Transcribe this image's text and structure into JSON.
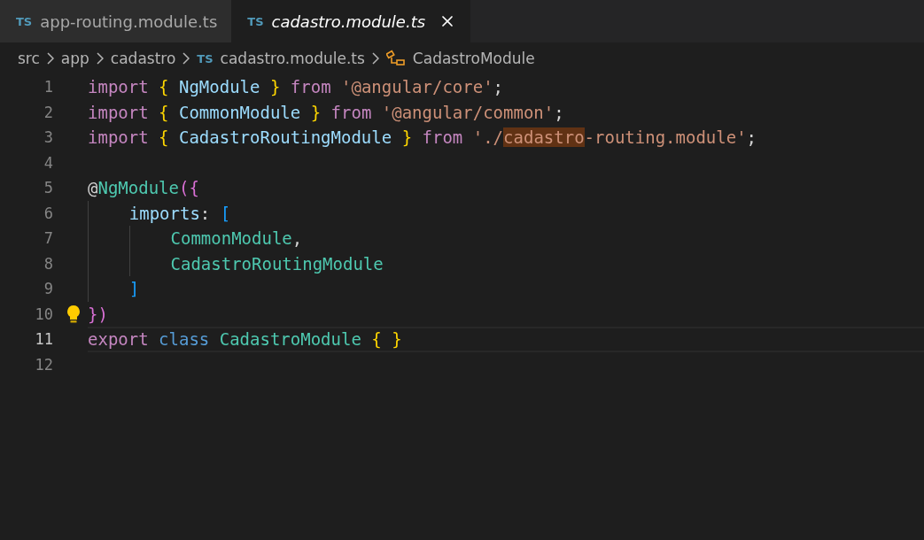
{
  "tabs": [
    {
      "badge": "TS",
      "label": "app-routing.module.ts",
      "selected": false
    },
    {
      "badge": "TS",
      "label": "cadastro.module.ts",
      "selected": true
    }
  ],
  "breadcrumbs": [
    {
      "kind": "folder",
      "label": "src"
    },
    {
      "kind": "folder",
      "label": "app"
    },
    {
      "kind": "folder",
      "label": "cadastro"
    },
    {
      "kind": "file",
      "badge": "TS",
      "label": "cadastro.module.ts"
    },
    {
      "kind": "symbol",
      "label": "CadastroModule"
    }
  ],
  "lines": [
    {
      "number": "1",
      "current": false,
      "tokens": [
        {
          "kind": "keyword",
          "text": "import "
        },
        {
          "kind": "brace",
          "text": "{"
        },
        {
          "kind": "variable",
          "text": " NgModule "
        },
        {
          "kind": "brace",
          "text": "} "
        },
        {
          "kind": "keyword",
          "text": "from "
        },
        {
          "kind": "string",
          "text": "'@angular/core'"
        },
        {
          "kind": "plain",
          "text": ";"
        }
      ]
    },
    {
      "number": "2",
      "current": false,
      "tokens": [
        {
          "kind": "keyword",
          "text": "import "
        },
        {
          "kind": "brace",
          "text": "{"
        },
        {
          "kind": "variable",
          "text": " CommonModule "
        },
        {
          "kind": "brace",
          "text": "} "
        },
        {
          "kind": "keyword",
          "text": "from "
        },
        {
          "kind": "string",
          "text": "'@angular/common'"
        },
        {
          "kind": "plain",
          "text": ";"
        }
      ]
    },
    {
      "number": "3",
      "current": false,
      "tokens": [
        {
          "kind": "keyword",
          "text": "import "
        },
        {
          "kind": "brace",
          "text": "{"
        },
        {
          "kind": "variable",
          "text": " CadastroRoutingModule "
        },
        {
          "kind": "brace",
          "text": "} "
        },
        {
          "kind": "keyword",
          "text": "from "
        },
        {
          "kind": "string",
          "text": "'./"
        },
        {
          "kind": "string-match",
          "text": "cadastro"
        },
        {
          "kind": "string",
          "text": "-routing.module'"
        },
        {
          "kind": "plain",
          "text": ";"
        }
      ]
    },
    {
      "number": "4",
      "current": false
    },
    {
      "number": "5",
      "current": false,
      "tokens": [
        {
          "kind": "plain",
          "text": "@"
        },
        {
          "kind": "type",
          "text": "NgModule"
        },
        {
          "kind": "paren",
          "text": "({"
        }
      ]
    },
    {
      "number": "6",
      "current": false,
      "tokens": [
        {
          "kind": "property",
          "text": "    imports"
        },
        {
          "kind": "plain",
          "text": ": "
        },
        {
          "kind": "bracket",
          "text": "["
        }
      ]
    },
    {
      "number": "7",
      "current": false,
      "tokens": [
        {
          "kind": "type",
          "text": "        CommonModule"
        },
        {
          "kind": "plain",
          "text": ","
        }
      ]
    },
    {
      "number": "8",
      "current": false,
      "tokens": [
        {
          "kind": "type",
          "text": "        CadastroRoutingModule"
        }
      ]
    },
    {
      "number": "9",
      "current": false,
      "tokens": [
        {
          "kind": "bracket",
          "text": "    ]"
        }
      ]
    },
    {
      "number": "10",
      "current": false,
      "lightbulb": true,
      "tokens": [
        {
          "kind": "paren",
          "text": "})"
        }
      ]
    },
    {
      "number": "11",
      "current": true,
      "tokens": [
        {
          "kind": "keyword",
          "text": "export "
        },
        {
          "kind": "storage",
          "text": "class "
        },
        {
          "kind": "type",
          "text": "CadastroModule "
        },
        {
          "kind": "brace",
          "text": "{ }"
        }
      ]
    },
    {
      "number": "12",
      "current": false
    }
  ]
}
